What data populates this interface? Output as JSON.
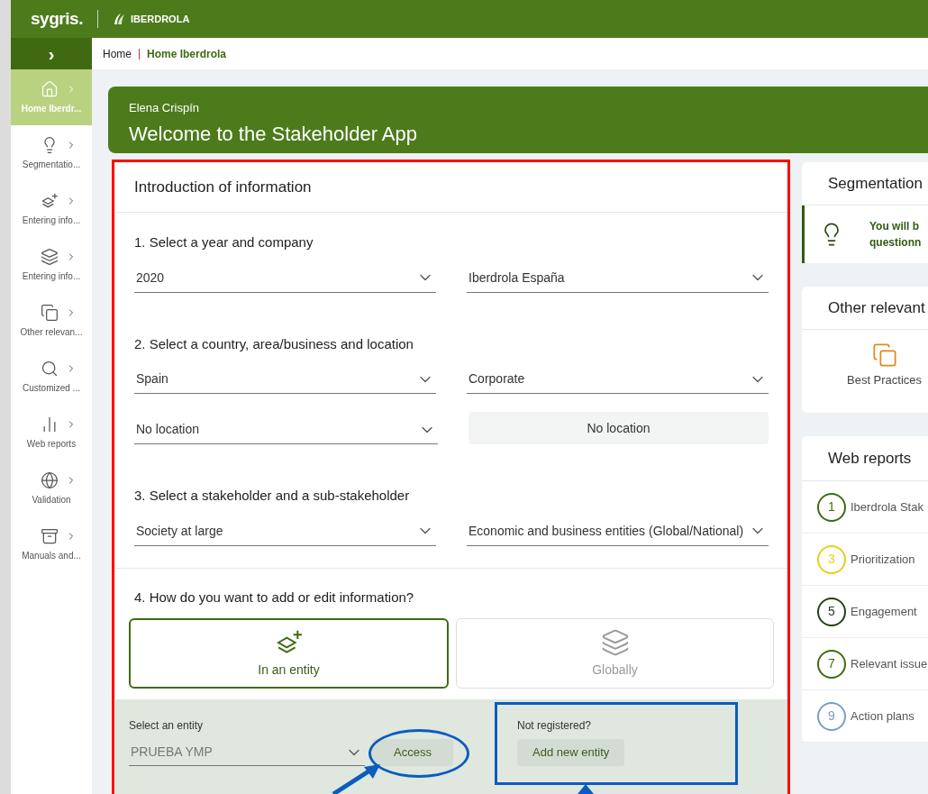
{
  "topbar": {
    "logo": "sygris.",
    "brand": "IBERDROLA"
  },
  "sidebar": {
    "toggle": "›",
    "items": [
      {
        "label": "Home Iberdr...",
        "kind": "home",
        "selected": true
      },
      {
        "label": "Segmentatio...",
        "kind": "bulb",
        "selected": false
      },
      {
        "label": "Entering info...",
        "kind": "entity",
        "selected": false
      },
      {
        "label": "Entering info...",
        "kind": "global",
        "selected": false
      },
      {
        "label": "Other relevan...",
        "kind": "other",
        "selected": false
      },
      {
        "label": "Customized ...",
        "kind": "search",
        "selected": false
      },
      {
        "label": "Web reports",
        "kind": "reports",
        "selected": false
      },
      {
        "label": "Validation",
        "kind": "validation",
        "selected": false
      },
      {
        "label": "Manuals and...",
        "kind": "manuals",
        "selected": false
      }
    ]
  },
  "breadcrumb": [
    {
      "label": "Home",
      "selected": false
    },
    {
      "label": "Home Iberdrola",
      "selected": true
    }
  ],
  "banner": {
    "user": "Elena Crispín",
    "title": "Welcome to the Stakeholder App"
  },
  "form": {
    "title": "Introduction of information",
    "sections": [
      {
        "heading": "1. Select a year and company",
        "rows": [
          [
            {
              "kind": "select",
              "value": "2020"
            },
            {
              "kind": "select",
              "value": "Iberdrola España"
            }
          ]
        ]
      },
      {
        "heading": "2. Select a country, area/business and location",
        "rows": [
          [
            {
              "kind": "select",
              "value": "Spain"
            },
            {
              "kind": "select",
              "value": "Corporate"
            }
          ],
          [
            {
              "kind": "select",
              "value": "No location"
            },
            {
              "kind": "static",
              "value": "No location"
            }
          ]
        ]
      },
      {
        "heading": "3. Select a stakeholder and a sub-stakeholder",
        "rows": [
          [
            {
              "kind": "select",
              "value": "Society at large"
            },
            {
              "kind": "select",
              "value": "Economic and business entities (Global/National)"
            }
          ]
        ]
      }
    ],
    "mode": {
      "heading": "4. How do you want to add or edit information?",
      "options": [
        {
          "label": "In an entity",
          "kind": "entity",
          "selected": true
        },
        {
          "label": "Globally",
          "kind": "global",
          "selected": false
        }
      ]
    },
    "entity": {
      "label": "Select an entity",
      "value": "PRUEBA YMP",
      "access": "Access",
      "prompt": "Not registered?",
      "add": "Add new entity"
    }
  },
  "segmentation": {
    "title": "Segmentation",
    "lines": [
      "You will b",
      "questionn"
    ]
  },
  "other": {
    "title": "Other relevant",
    "items": [
      "Best Practices"
    ]
  },
  "web_reports": {
    "title": "Web reports",
    "items": [
      {
        "number": "1",
        "label": "Iberdrola Stak",
        "color": "#3d6b12"
      },
      {
        "number": "3",
        "label": "Prioritization",
        "color": "#e6cf1c"
      },
      {
        "number": "5",
        "label": "Engagement",
        "color": "#24401a"
      },
      {
        "number": "7",
        "label": "Relevant issue",
        "color": "#3d6b12"
      },
      {
        "number": "9",
        "label": "Action plans",
        "color": "#7d9cc9"
      }
    ]
  }
}
